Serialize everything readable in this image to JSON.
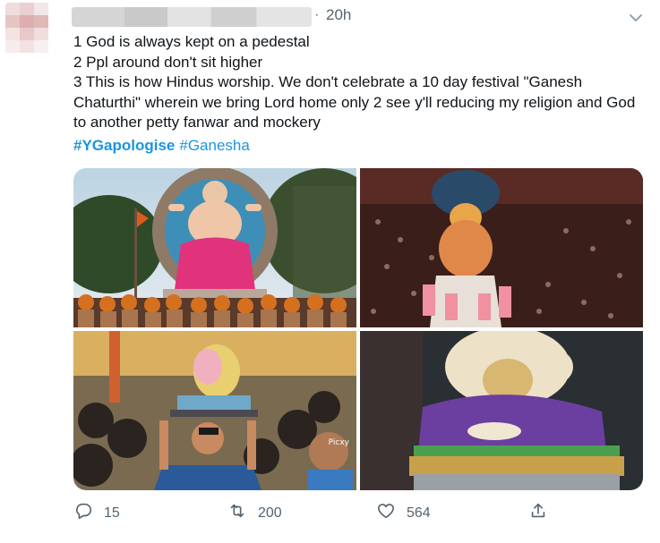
{
  "tweet": {
    "timestamp": "20h",
    "separator": "·",
    "lines": [
      "1 God is always kept on a pedestal",
      "2 Ppl around don't sit higher",
      "3 This is how Hindus worship. We don't celebrate a 10 day festival \"Ganesh Chaturthi\" wherein we bring Lord home only 2 see y'll reducing my religion and God to another petty fanwar and mockery"
    ],
    "hashtags": [
      "#YGapologise",
      "#Ganesha"
    ]
  },
  "media": {
    "watermark": "Picxy"
  },
  "actions": {
    "reply_count": "15",
    "retweet_count": "200",
    "like_count": "564"
  },
  "colors": {
    "link": "#1b95e0",
    "muted": "#536471"
  },
  "icons": [
    "chevron-down-icon",
    "reply-icon",
    "retweet-icon",
    "like-icon",
    "share-icon"
  ]
}
